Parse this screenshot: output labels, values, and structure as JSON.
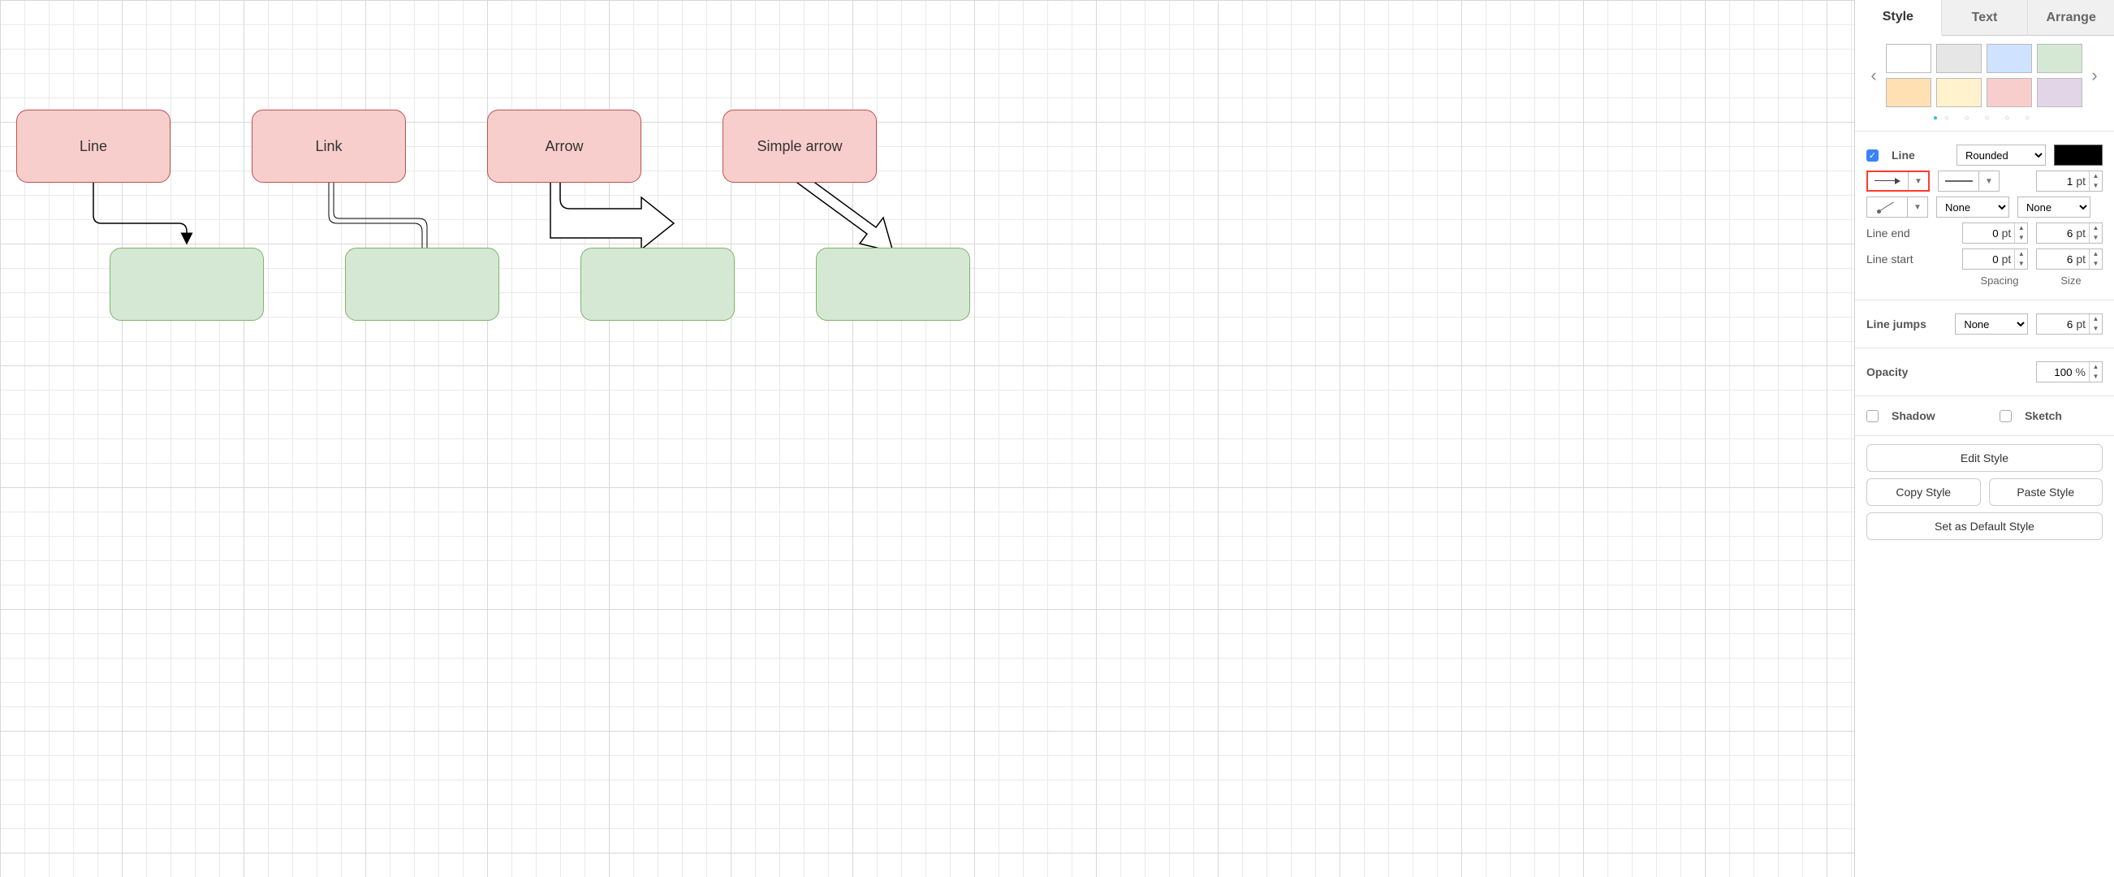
{
  "canvas": {
    "nodes": {
      "line": {
        "label": "Line"
      },
      "link": {
        "label": "Link"
      },
      "arrow": {
        "label": "Arrow"
      },
      "simple": {
        "label": "Simple arrow"
      }
    }
  },
  "sidebar": {
    "tabs": {
      "style": "Style",
      "text": "Text",
      "arrange": "Arrange"
    },
    "palette": {
      "colors_row1": [
        "#ffffff",
        "#e6e6e6",
        "#cfe2ff",
        "#d5e8d4"
      ],
      "colors_row2": [
        "#ffe0b3",
        "#fff2cc",
        "#f8cecc",
        "#e1d5e7"
      ]
    },
    "line": {
      "label": "Line",
      "style_select": "Rounded",
      "connection_style": "arrow",
      "stroke_style": "solid",
      "width_value": "1",
      "width_unit": "pt",
      "waypoint": "straight",
      "end_style": "None",
      "start_style": "None",
      "end_label": "Line end",
      "start_label": "Line start",
      "end_spacing": "0",
      "end_size": "6",
      "start_spacing": "0",
      "start_size": "6",
      "col_spacing": "Spacing",
      "col_size": "Size",
      "unit": "pt"
    },
    "jumps": {
      "label": "Line jumps",
      "style": "None",
      "size": "6",
      "unit": "pt"
    },
    "opacity": {
      "label": "Opacity",
      "value": "100",
      "unit": "%"
    },
    "effects": {
      "shadow": "Shadow",
      "sketch": "Sketch"
    },
    "buttons": {
      "edit": "Edit Style",
      "copy": "Copy Style",
      "paste": "Paste Style",
      "default": "Set as Default Style"
    }
  }
}
